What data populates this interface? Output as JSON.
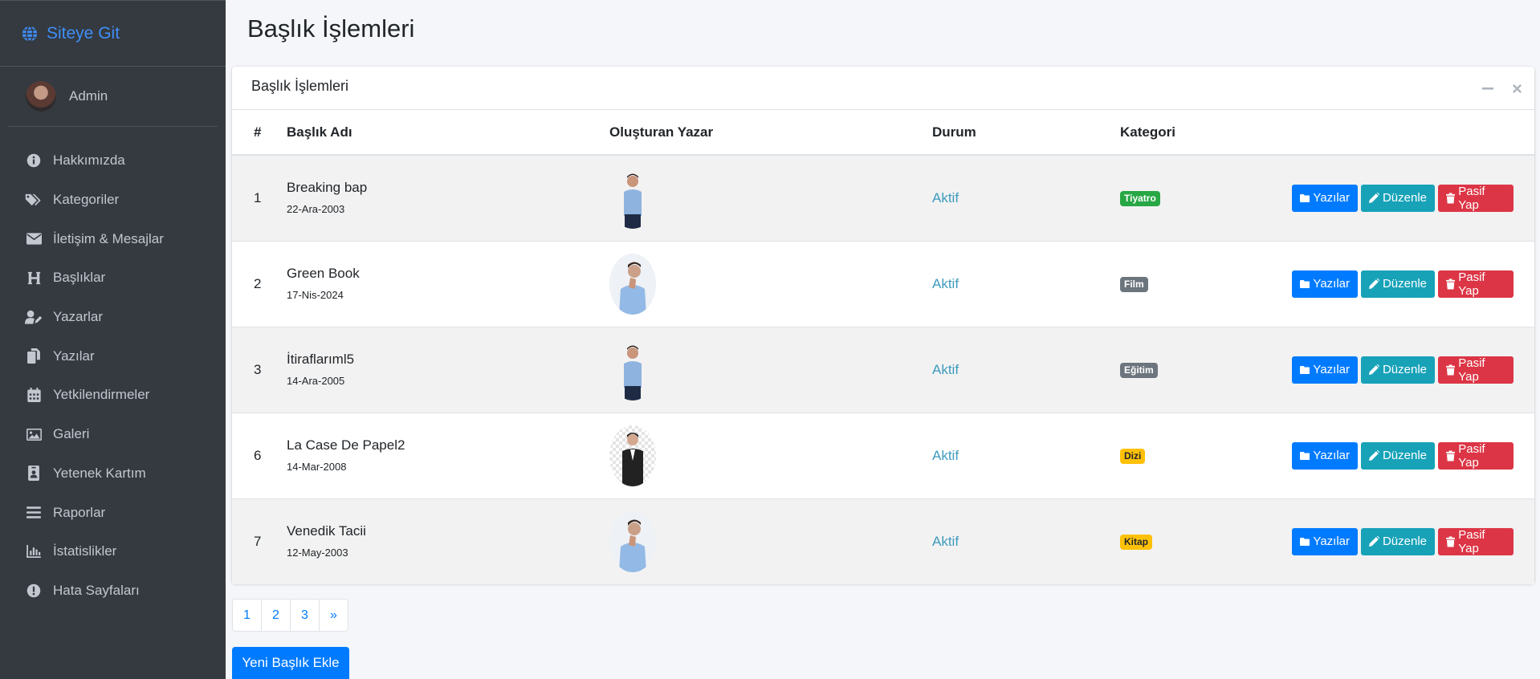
{
  "brand": {
    "label": "Siteye Git",
    "icon": "globe-icon"
  },
  "user": {
    "name": "Admin"
  },
  "sidebar": {
    "items": [
      {
        "label": "Hakkımızda",
        "icon": "info-circle-icon"
      },
      {
        "label": "Kategoriler",
        "icon": "tags-icon"
      },
      {
        "label": "İletişim & Mesajlar",
        "icon": "envelope-icon"
      },
      {
        "label": "Başlıklar",
        "icon": "heading-icon"
      },
      {
        "label": "Yazarlar",
        "icon": "user-edit-icon"
      },
      {
        "label": "Yazılar",
        "icon": "copy-icon"
      },
      {
        "label": "Yetkilendirmeler",
        "icon": "calendar-icon"
      },
      {
        "label": "Galeri",
        "icon": "image-icon"
      },
      {
        "label": "Yetenek Kartım",
        "icon": "id-badge-icon"
      },
      {
        "label": "Raporlar",
        "icon": "bars-icon"
      },
      {
        "label": "İstatislikler",
        "icon": "chart-bar-icon"
      },
      {
        "label": "Hata Sayfaları",
        "icon": "exclamation-circle-icon"
      }
    ]
  },
  "page": {
    "title": "Başlık İşlemleri"
  },
  "card": {
    "title": "Başlık İşlemleri",
    "columns": {
      "num": "#",
      "title": "Başlık Adı",
      "author": "Oluşturan Yazar",
      "status": "Durum",
      "category": "Kategori"
    },
    "rows": [
      {
        "num": "1",
        "title": "Breaking bap",
        "date": "22-Ara-2003",
        "status": "Aktif",
        "category": "Tiyatro",
        "badge_color": "#28a745"
      },
      {
        "num": "2",
        "title": "Green Book",
        "date": "17-Nis-2024",
        "status": "Aktif",
        "category": "Film",
        "badge_color": "#6c757d"
      },
      {
        "num": "3",
        "title": "İtiraflarıml5",
        "date": "14-Ara-2005",
        "status": "Aktif",
        "category": "Eğitim",
        "badge_color": "#6c757d"
      },
      {
        "num": "6",
        "title": "La Case De Papel2",
        "date": "14-Mar-2008",
        "status": "Aktif",
        "category": "Dizi",
        "badge_color": "#ffc107"
      },
      {
        "num": "7",
        "title": "Venedik Tacii",
        "date": "12-May-2003",
        "status": "Aktif",
        "category": "Kitap",
        "badge_color": "#ffc107"
      }
    ],
    "actions": {
      "posts": "Yazılar",
      "edit": "Düzenle",
      "deactivate": "Pasif Yap"
    }
  },
  "pagination": {
    "pages": [
      "1",
      "2",
      "3"
    ],
    "next": "»"
  },
  "add_button": "Yeni Başlık Ekle",
  "colors": {
    "primary": "#007bff",
    "info": "#17a2b8",
    "danger": "#dc3545",
    "sidebar": "#343a40"
  }
}
